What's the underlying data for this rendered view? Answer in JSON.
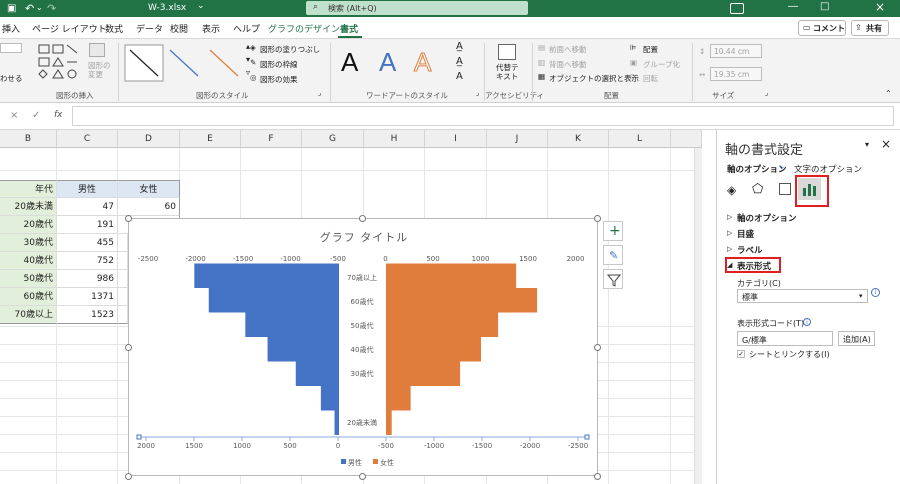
{
  "titlebar": {
    "qat_icons": [
      "save-icon",
      "undo-icon",
      "redo-icon"
    ],
    "filename": "W-3.xlsx",
    "dropdown": "⌄",
    "search_placeholder": "検索 (Alt+Q)",
    "window_controls": [
      "―",
      "□",
      "×"
    ]
  },
  "tabs": [
    "挿入",
    "ページ レイアウト",
    "数式",
    "データ",
    "校閲",
    "表示",
    "ヘルプ",
    "グラフのデザイン",
    "書式"
  ],
  "active_tab": "書式",
  "comment_button": "コメント",
  "share_button": "共有",
  "ribbon": {
    "insert_shapes": {
      "label": "図形の挿入",
      "small_left": "わせる",
      "change_shape": "図形の\n変更"
    },
    "shape_styles": {
      "label": "図形のスタイル",
      "fill": "図形の塗りつぶし",
      "outline": "図形の枠線",
      "effects": "図形の効果"
    },
    "wordart": {
      "label": "ワードアートのスタイル",
      "sample": "A"
    },
    "accessibility": {
      "label": "アクセシビリティ",
      "alt_text": "代替テ\nキスト"
    },
    "arrange": {
      "label": "配置",
      "bring_forward": "前面へ移動",
      "send_backward": "背面へ移動",
      "selection_pane": "オブジェクトの選択と表示",
      "align": "配置",
      "group": "グループ化",
      "rotate": "回転"
    },
    "size": {
      "label": "サイズ",
      "height": "10.44 cm",
      "width": "19.35 cm"
    }
  },
  "formula": {
    "cancel": "×",
    "enter": "✓",
    "fx": "fx",
    "value": ""
  },
  "columns": [
    "B",
    "C",
    "D",
    "E",
    "F",
    "G",
    "H",
    "I",
    "J",
    "K",
    "L"
  ],
  "table": {
    "headers": [
      "年代",
      "男性",
      "女性"
    ],
    "rows": [
      {
        "label": "20歳未満",
        "male": "47",
        "female": "60"
      },
      {
        "label": "20歳代",
        "male": "191",
        "female": "259"
      },
      {
        "label": "30歳代",
        "male": "455",
        "female": ""
      },
      {
        "label": "40歳代",
        "male": "752",
        "female": ""
      },
      {
        "label": "50歳代",
        "male": "986",
        "female": ""
      },
      {
        "label": "60歳代",
        "male": "1371",
        "female": ""
      },
      {
        "label": "70歳以上",
        "male": "1523",
        "female": ""
      }
    ]
  },
  "chart_data": {
    "type": "bar",
    "title": "グラフ タイトル",
    "categories": [
      "20歳未満",
      "20歳代",
      "30歳代",
      "40歳代",
      "50歳代",
      "60歳代",
      "70歳以上"
    ],
    "category_axis_labels": [
      "20歳未満",
      "30歳代",
      "40歳代",
      "50歳代",
      "60歳代",
      "70歳以上"
    ],
    "series": [
      {
        "name": "男性",
        "values": [
          47,
          191,
          455,
          752,
          986,
          1371,
          1523
        ],
        "color": "#4472c4"
      },
      {
        "name": "女性",
        "values": [
          60,
          259,
          780,
          1000,
          1180,
          1590,
          1370
        ],
        "color": "#e07d3c"
      }
    ],
    "top_axis": {
      "ticks": [
        "-2500",
        "-2000",
        "-1500",
        "-1000",
        "-500",
        "0",
        "500",
        "1000",
        "1500",
        "2000"
      ]
    },
    "bottom_axis": {
      "ticks": [
        "2000",
        "1500",
        "1000",
        "500",
        "0",
        "-500",
        "-1000",
        "-1500",
        "-2000",
        "-2500"
      ]
    },
    "legend_position": "bottom"
  },
  "chart_tools": [
    "plus-icon",
    "brush-icon",
    "filter-icon"
  ],
  "pane": {
    "title": "軸の書式設定",
    "options_tab": "軸のオプション",
    "text_tab": "文字のオプション",
    "icons": [
      "fill-icon",
      "pentagon-icon",
      "size-props-icon",
      "bar-chart-icon"
    ],
    "sections": [
      "軸のオプション",
      "目盛",
      "ラベル",
      "表示形式"
    ],
    "category_label": "カテゴリ(C)",
    "category_value": "標準",
    "format_code_label": "表示形式コード(T)",
    "format_code_value": "G/標準",
    "add_button": "追加(A)",
    "link_label": "シートとリンクする(I)",
    "link_checked": true
  }
}
